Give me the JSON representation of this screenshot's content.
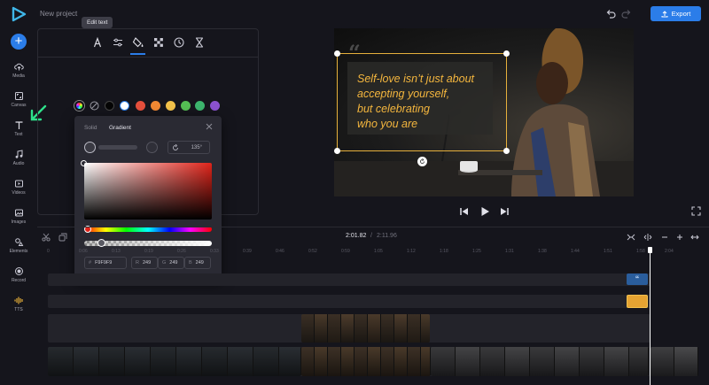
{
  "app": {
    "project_title": "New project",
    "tooltip": "Edit text",
    "export_label": "Export",
    "accent_color": "#2b7de9"
  },
  "sidebar": {
    "items": [
      {
        "label": "Media"
      },
      {
        "label": "Canvas"
      },
      {
        "label": "Text"
      },
      {
        "label": "Audio"
      },
      {
        "label": "Videos"
      },
      {
        "label": "Images"
      },
      {
        "label": "Elements"
      },
      {
        "label": "Record"
      },
      {
        "label": "TTS"
      }
    ]
  },
  "editor": {
    "tools": [
      "text-font-icon",
      "text-adjust-icon",
      "fill-color-icon",
      "transparency-icon",
      "timing-icon",
      "animation-icon"
    ],
    "active_tool": "fill-color-icon",
    "swatches": [
      "#ffffff",
      "#e54f3c",
      "#f08833",
      "#f2c14a",
      "#55bd54",
      "#3cb46d",
      "#3579e3",
      "#8b52cf"
    ]
  },
  "picker": {
    "tab_solid": "Solid",
    "tab_gradient": "Gradient",
    "active_tab": "Gradient",
    "angle": "135°",
    "hex_label": "#",
    "hex": "F9F9F9",
    "r_label": "R",
    "r": "249",
    "g_label": "G",
    "g": "249",
    "b_label": "B",
    "b": "249"
  },
  "preview": {
    "quote_lines": [
      "Self-love isn’t just about",
      "accepting yourself,",
      "but celebrating",
      "who you are"
    ],
    "text_color": "#f4b63e"
  },
  "timeline": {
    "current_time": "2:01.82",
    "separator": "/",
    "total_time": "2:11.96",
    "ruler_marks": [
      "0",
      "0:06",
      "0:13",
      "0:19",
      "0:26",
      "0:33",
      "0:39",
      "0:46",
      "0:52",
      "0:59",
      "1:05",
      "1:12",
      "1:18",
      "1:25",
      "1:31",
      "1:38",
      "1:44",
      "1:51",
      "1:58",
      "2:04"
    ]
  }
}
